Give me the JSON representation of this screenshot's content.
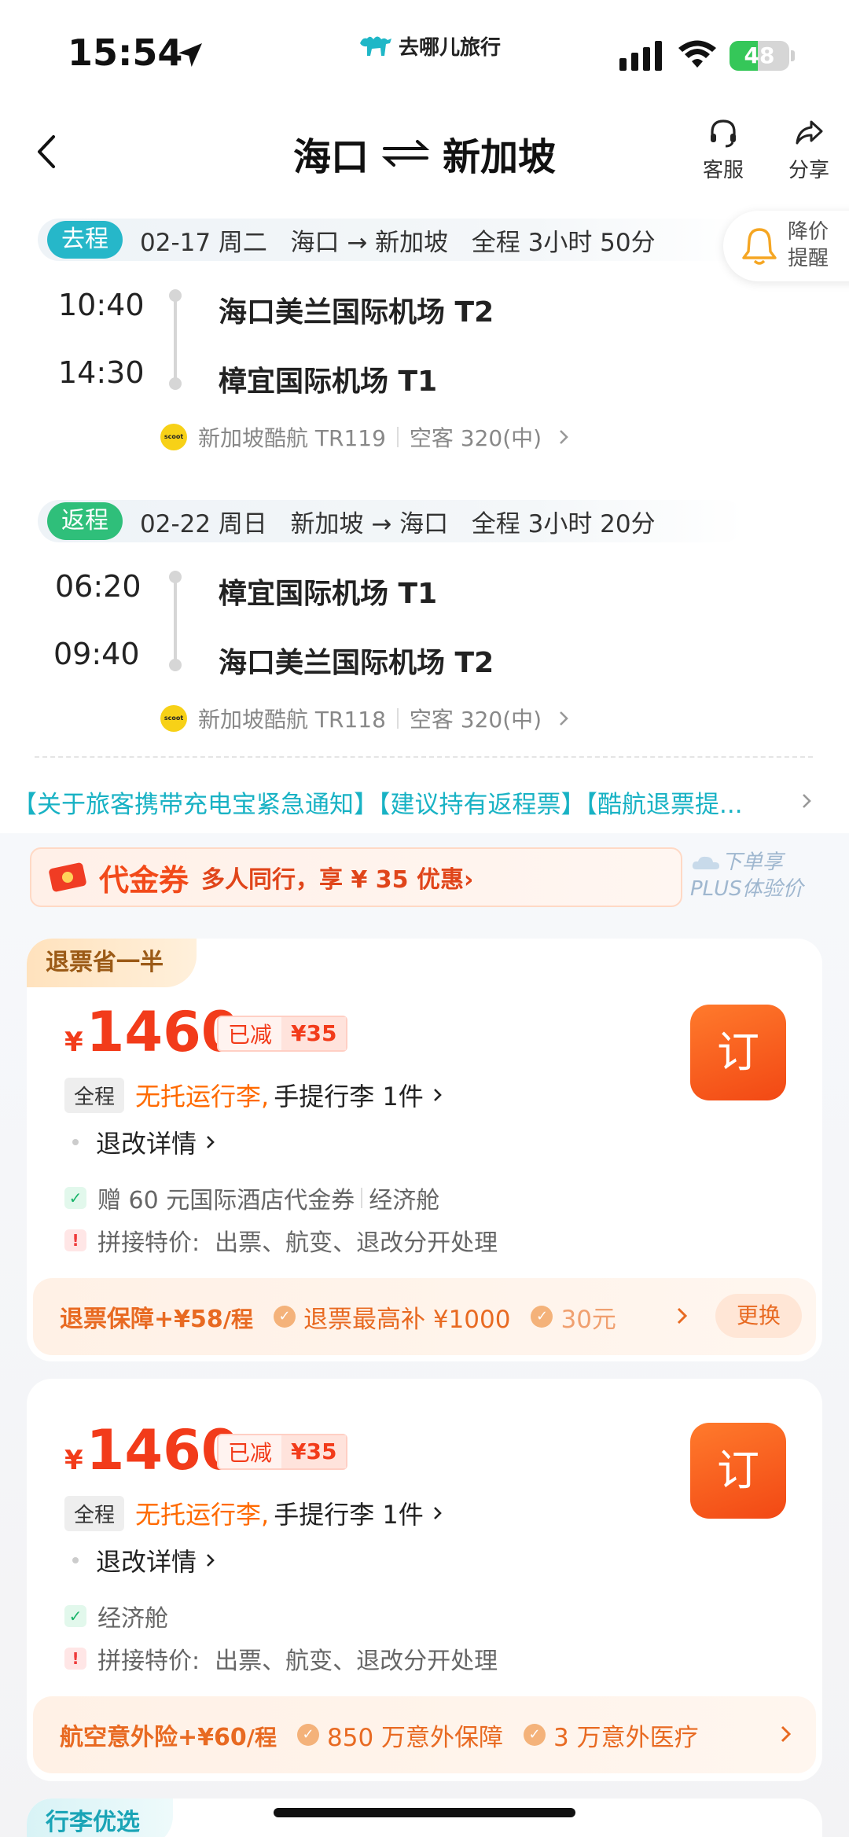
{
  "status_bar": {
    "time": "15:54",
    "brand": "去哪儿旅行",
    "battery": "48",
    "battery_level": 0.48
  },
  "header": {
    "origin": "海口",
    "destination": "新加坡",
    "service_label": "客服",
    "share_label": "分享"
  },
  "price_alert": {
    "line1": "降价",
    "line2": "提醒"
  },
  "outbound": {
    "tag": "去程",
    "info": "02-17 周二   海口 → 新加坡   全程 3小时 50分",
    "depart_time": "10:40",
    "depart_airport": "海口美兰国际机场 T2",
    "arrive_time": "14:30",
    "arrive_airport": "樟宜国际机场 T1",
    "airline": "新加坡酷航 TR119",
    "aircraft": "空客 320(中)"
  },
  "return": {
    "tag": "返程",
    "info": "02-22 周日   新加坡 → 海口   全程 3小时 20分",
    "depart_time": "06:20",
    "depart_airport": "樟宜国际机场 T1",
    "arrive_time": "09:40",
    "arrive_airport": "海口美兰国际机场 T2",
    "airline": "新加坡酷航 TR118",
    "aircraft": "空客 320(中)"
  },
  "notice": "【关于旅客携带充电宝紧急通知】【建议持有返程票】【酷航退票提...",
  "coupon": {
    "title": "代金券",
    "text": "多人同行，享 ¥ 35 优惠›",
    "plus_line1": "下单享",
    "plus_line2": "PLUS体验价"
  },
  "cards": [
    {
      "badge": "退票省一半",
      "currency": "¥",
      "price": "1460",
      "off_label": "已减",
      "off_value": "¥35",
      "book": "订",
      "full_tag": "全程",
      "no_bag": "无托运行李,",
      "hand_bag": "手提行李 1件",
      "change": "退改详情",
      "gift": "赠 60 元国际酒店代金券",
      "cabin": "经济舱",
      "warn": "拼接特价:  出票、航变、退改分开处理",
      "ins_title": "退票保障+¥58",
      "ins_unit": "/程",
      "ins_item1": "退票最高补 ¥1000",
      "ins_item2": "30元",
      "swap": "更换"
    },
    {
      "currency": "¥",
      "price": "1460",
      "off_label": "已减",
      "off_value": "¥35",
      "book": "订",
      "full_tag": "全程",
      "no_bag": "无托运行李,",
      "hand_bag": "手提行李 1件",
      "change": "退改详情",
      "cabin": "经济舱",
      "warn": "拼接特价:  出票、航变、退改分开处理",
      "ins_title": "航空意外险+¥60",
      "ins_unit": "/程",
      "ins_item1": "850 万意外保障",
      "ins_item2": "3 万意外医疗"
    }
  ],
  "next_badge": "行李优选"
}
